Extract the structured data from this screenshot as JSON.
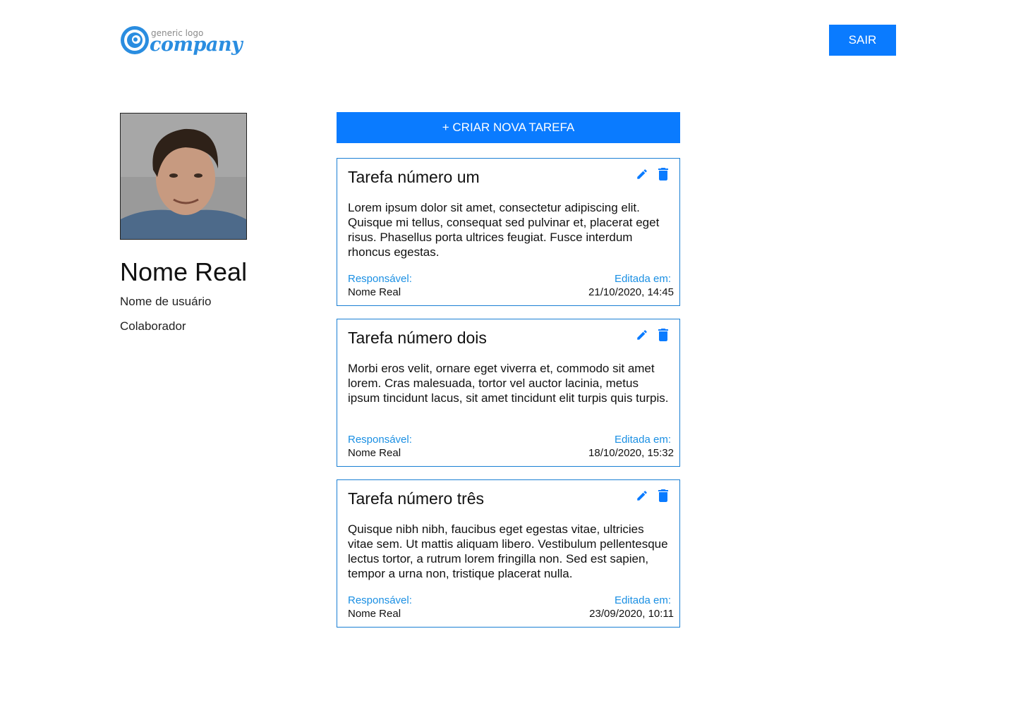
{
  "header": {
    "logo_small": "generic logo",
    "logo_big": "company",
    "logout_label": "SAIR"
  },
  "profile": {
    "name": "Nome Real",
    "username": "Nome de usuário",
    "role": "Colaborador"
  },
  "actions": {
    "create_task_label": "+ CRIAR NOVA TAREFA"
  },
  "labels": {
    "responsible": "Responsável:",
    "edited_at": "Editada em:"
  },
  "tasks": [
    {
      "title": "Tarefa número um",
      "description": "Lorem ipsum dolor sit amet, consectetur adipiscing elit. Quisque mi tellus, consequat sed pulvinar et, placerat eget risus. Phasellus porta ultrices feugiat. Fusce interdum rhoncus egestas.",
      "responsible": "Nome Real",
      "edited_at": "21/10/2020, 14:45"
    },
    {
      "title": "Tarefa número dois",
      "description": "Morbi eros velit, ornare eget viverra et, commodo sit amet lorem. Cras malesuada, tortor vel auctor lacinia, metus ipsum tincidunt lacus, sit amet tincidunt elit turpis quis turpis.",
      "responsible": "Nome Real",
      "edited_at": "18/10/2020, 15:32"
    },
    {
      "title": "Tarefa número três",
      "description": "Quisque nibh nibh, faucibus eget egestas vitae, ultricies vitae sem. Ut mattis aliquam libero. Vestibulum pellentesque lectus tortor, a rutrum lorem fringilla non. Sed est sapien, tempor a urna non, tristique placerat nulla.",
      "responsible": "Nome Real",
      "edited_at": "23/09/2020, 10:11"
    }
  ],
  "colors": {
    "primary": "#0a7bff",
    "card_border": "#1a7fd4",
    "label_blue": "#1a8fe3"
  },
  "icons": {
    "edit": "pencil-icon",
    "delete": "trash-icon"
  }
}
